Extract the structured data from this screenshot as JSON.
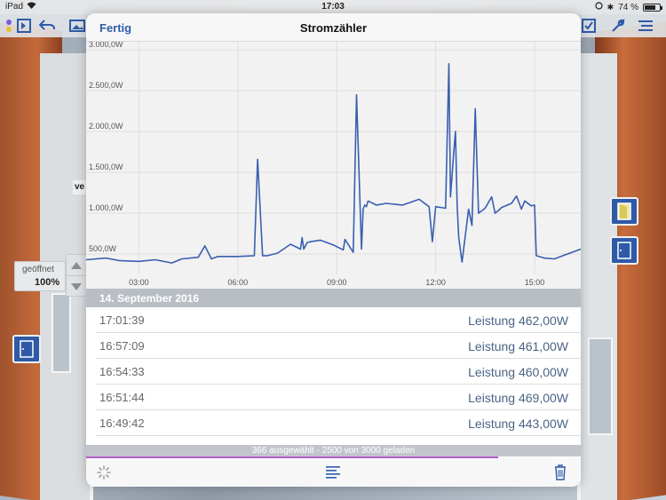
{
  "status_bar": {
    "device": "iPad",
    "time": "17:03",
    "battery": "74 %",
    "battery_level": 0.74
  },
  "background_app": {
    "opened_label": "geöffnet",
    "opened_value": "100%",
    "partial_label": "ve"
  },
  "modal": {
    "done_label": "Fertig",
    "title": "Stromzähler",
    "date_header": "14. September 2016",
    "entries": [
      {
        "time": "17:01:39",
        "value": "Leistung 462,00W"
      },
      {
        "time": "16:57:09",
        "value": "Leistung 461,00W"
      },
      {
        "time": "16:54:33",
        "value": "Leistung 460,00W"
      },
      {
        "time": "16:51:44",
        "value": "Leistung 469,00W"
      },
      {
        "time": "16:49:42",
        "value": "Leistung 443,00W"
      }
    ],
    "info_text": "366 ausgewählt - 2500 von 3000 geladen",
    "loaded_fraction": 0.833
  },
  "chart_data": {
    "type": "line",
    "title": "",
    "xlabel": "",
    "ylabel": "",
    "x_ticks": [
      "03:00",
      "06:00",
      "09:00",
      "12:00",
      "15:00"
    ],
    "y_ticks": [
      "500,0W",
      "1.000,0W",
      "1.500,0W",
      "2.000,0W",
      "2.500,0W",
      "3.000,0W"
    ],
    "x_range_hours": [
      1.4,
      16.4
    ],
    "ylim": [
      250,
      3100
    ],
    "line_color": "#3a5fb0",
    "series": [
      {
        "x": [
          1.4,
          2.0,
          2.4,
          3.0,
          3.5,
          4.0,
          4.3,
          4.8,
          5.0,
          5.2,
          5.4,
          5.7,
          6.0,
          6.5,
          6.6,
          6.75,
          6.9,
          7.2,
          7.6,
          7.9,
          7.95,
          8.0,
          8.1,
          8.2,
          8.5,
          8.9,
          9.2,
          9.25,
          9.5,
          9.6,
          9.75,
          9.8,
          9.85,
          9.9,
          9.95,
          10.2,
          10.5,
          11.0,
          11.5,
          11.8,
          11.9,
          12.0,
          12.3,
          12.4,
          12.45,
          12.55,
          12.6,
          12.65,
          12.7,
          12.8,
          13.0,
          13.1,
          13.2,
          13.3,
          13.5,
          13.7,
          13.8,
          13.95,
          14.0,
          14.3,
          14.45,
          14.6,
          14.7,
          14.9,
          15.0,
          15.05,
          15.3,
          15.6,
          16.0,
          16.4
        ],
        "y": [
          430,
          450,
          420,
          410,
          430,
          390,
          440,
          460,
          600,
          440,
          470,
          470,
          470,
          480,
          1660,
          480,
          480,
          510,
          620,
          560,
          700,
          560,
          640,
          650,
          670,
          610,
          550,
          680,
          520,
          2450,
          560,
          1050,
          1100,
          1080,
          1150,
          1100,
          1120,
          1100,
          1170,
          1080,
          650,
          1080,
          1060,
          2830,
          1200,
          1750,
          2000,
          1100,
          700,
          400,
          1050,
          850,
          2280,
          1000,
          1060,
          1200,
          1000,
          1050,
          1070,
          1120,
          1210,
          1050,
          1150,
          1090,
          1100,
          480,
          450,
          440,
          500,
          560
        ]
      }
    ]
  }
}
